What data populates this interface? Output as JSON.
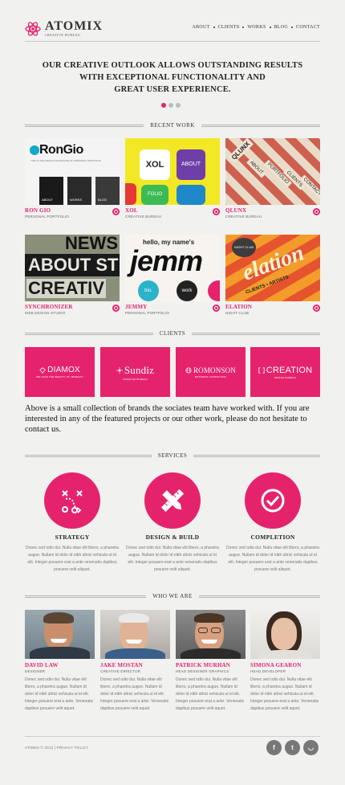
{
  "brand": {
    "name": "ATOMIX",
    "tagline": "CREATIVE BUREAU"
  },
  "nav": [
    "ABOUT",
    "CLIENTS",
    "WORKS",
    "BLOG",
    "CONTACT"
  ],
  "hero": {
    "line1": "OUR CREATIVE OUTLOOK ALLOWS OUTSTANDING RESULTS",
    "line2": "WITH EXCEPTIONAL FUNCTIONALITY AND",
    "line3": "GREAT USER EXPERIENCE."
  },
  "sections": {
    "recent_work": "RECENT WORK",
    "clients": "CLIENTS",
    "services": "SERVICES",
    "who_we_are": "WHO WE ARE"
  },
  "works": [
    {
      "title": "RON GIO",
      "subtitle": "PERSONAL PORTFOLIO",
      "art": "RonGio",
      "art_sub": "THIS IS THE DESIGN SHOWCASE OF PERSONAL PORTFOLIO",
      "tiles": [
        "ABOUT",
        "WORKS",
        "BLOG"
      ]
    },
    {
      "title": "XOL",
      "subtitle": "CREATIVE BUREAU",
      "art": "XOL",
      "tiles": [
        "ABOUT",
        "FOLIO"
      ]
    },
    {
      "title": "QLUNX",
      "subtitle": "CREATIVE BUREAU",
      "art": "QLUNX",
      "tiles": [
        "ABOUT",
        "PORTFOLIO",
        "CLIENTS",
        "CONTACTS"
      ]
    },
    {
      "title": "SYNCHRONIZER",
      "subtitle": "WEB DESIGN STUDIO",
      "art_lines": [
        "NEWS",
        "ABOUT ST",
        "CREATIV"
      ]
    },
    {
      "title": "JEMMY",
      "subtitle": "PERSONAL PORTFOLIO",
      "art_top": "hello, my name's",
      "art": "jemm",
      "tiles": [
        "bio.",
        "work"
      ]
    },
    {
      "title": "ELATION",
      "subtitle": "NIGHT CLUB",
      "art": "elation",
      "tiles": [
        "NIGHT CLUB",
        "CLIENTS",
        "ARTISTS"
      ]
    }
  ],
  "clients": [
    {
      "name": "DIAMOX",
      "sub": "WE HAVE THE BEAUTY OF JEWELRY"
    },
    {
      "name": "Sundiz",
      "sub": "CREATIVE BUREAU"
    },
    {
      "name": "ROMONSON",
      "sub": "BUSINESS CONSULTING"
    },
    {
      "name": "CREATION",
      "sub": "DESIGN BUREAU"
    }
  ],
  "about_text": "Above is a small collection of brands the sociates team have worked with. If you are interested in any of the featured projects or our other work, please do not hesitate to contact us.",
  "services": [
    {
      "title": "STRATEGY",
      "icon": "strategy-icon",
      "text": "Donec sed odio dui. Nulla vitae elit libero, a pharetra augue. Nullam id dolor id nibh ultrici vehicula ut id elit. Integer posuere erat a ante venenatis dapibus posuere velit aliquet."
    },
    {
      "title": "DESIGN & BUILD",
      "icon": "pencil-ruler-icon",
      "text": "Donec sed odio dui. Nulla vitae elit libero, a pharetra augue. Nullam id dolor id nibh ultrici vehicula ut id elit. Integer posuere erat a ante venenatis dapibus posuere velit aliquet."
    },
    {
      "title": "COMPLETION",
      "icon": "checkmark-icon",
      "text": "Donec sed odio dui. Nulla vitae elit libero, a pharetra augue. Nullam id dolor id nibh ultrici vehicula ut id elit. Integer posuere erat a ante venenatis dapibus posuere velit aliquet."
    }
  ],
  "team": [
    {
      "name": "DAVID LAW",
      "role": "DESIGNER",
      "text": "Donec sed odio dui. Nulla vitae elit libero, a pharetra augue. Nullam id dolor id nibh ultrici vehicula ut id elit. Integer posuere erat a ante. Venenatis dapibus posuere velit aquet."
    },
    {
      "name": "JAKE MOSTAN",
      "role": "CREATIVE DIRECTOR",
      "text": "Donec sed odio dui. Nulla vitae elit libero, a pharetra augue. Nullam id dolor id nibh ultrici vehicula ut id elit. Integer posuere erat a ante. Venenatis dapibus posuere velit aquet."
    },
    {
      "name": "PATRICK MURHAN",
      "role": "HEAD DESIGNER GRAPHICS",
      "text": "Donec sed odio dui. Nulla vitae elit libero, a pharetra augue. Nullam id dolor id nibh ultrici vehicula ut id elit. Integer posuere erat a ante. Venenatis dapibus posuere velit aquet."
    },
    {
      "name": "SIMONA GEARON",
      "role": "HEAD DEVELOPER",
      "text": "Donec sed odio dui. Nulla vitae elit libero, a pharetra augue. Nullam id dolor id nibh ultrici vehicula ut id elit. Integer posuere erat a ante. Venenatis dapibus posuere velit aquet."
    }
  ],
  "footer": {
    "copyright": "ATOMIX © 2013 | PRIVACY POLICY",
    "social": [
      {
        "icon": "facebook-icon",
        "glyph": "f"
      },
      {
        "icon": "twitter-icon",
        "glyph": "t"
      },
      {
        "icon": "rss-icon",
        "glyph": "◡"
      }
    ]
  },
  "colors": {
    "accent": "#e5236c",
    "background": "#f1f1ef"
  }
}
